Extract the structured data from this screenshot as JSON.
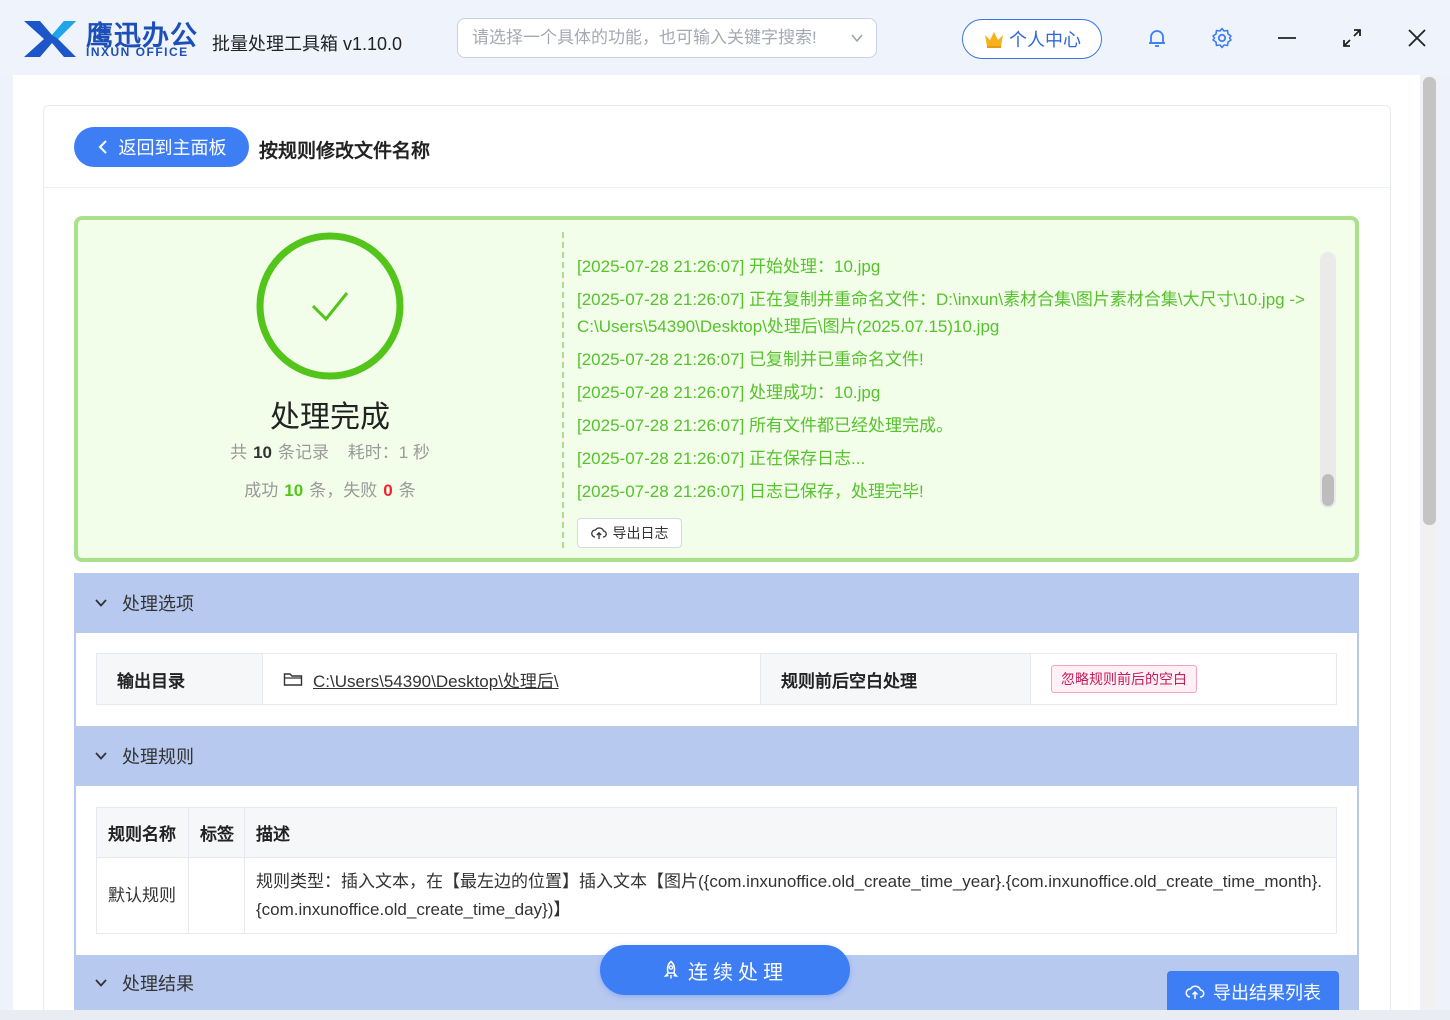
{
  "header": {
    "brand_cn": "鹰迅办公",
    "brand_en": "INXUN OFFICE",
    "app_name": "批量处理工具箱 v1.10.0",
    "search_placeholder": "请选择一个具体的功能，也可输入关键字搜索!",
    "user_center": "个人中心",
    "icons": [
      "logo-icon",
      "crown-icon",
      "bell-icon",
      "gear-icon",
      "minimize-icon",
      "maximize-icon",
      "close-icon"
    ]
  },
  "page": {
    "back_label": "返回到主面板",
    "title": "按规则修改文件名称"
  },
  "result": {
    "status": "处理完成",
    "total_prefix": "共",
    "total": "10",
    "total_suffix": "条记录",
    "time_label": "耗时：1 秒",
    "success_prefix": "成功",
    "success": "10",
    "success_suffix": "条，失败",
    "fail": "0",
    "fail_suffix": "条",
    "export_log": "导出日志",
    "logs": [
      "[2025-07-28 21:26:07] 开始处理：10.jpg",
      "[2025-07-28 21:26:07] 正在复制并重命名文件：D:\\inxun\\素材合集\\图片素材合集\\大尺寸\\10.jpg -> C:\\Users\\54390\\Desktop\\处理后\\图片(2025.07.15)10.jpg",
      "[2025-07-28 21:26:07] 已复制并已重命名文件!",
      "[2025-07-28 21:26:07] 处理成功：10.jpg",
      "[2025-07-28 21:26:07] 所有文件都已经处理完成。",
      "[2025-07-28 21:26:07] 正在保存日志...",
      "[2025-07-28 21:26:07] 日志已保存，处理完毕!"
    ]
  },
  "options": {
    "section_title": "处理选项",
    "output_dir_label": "输出目录",
    "output_dir_value": "C:\\Users\\54390\\Desktop\\处理后\\",
    "whitespace_label": "规则前后空白处理",
    "whitespace_value": "忽略规则前后的空白"
  },
  "rules": {
    "section_title": "处理规则",
    "columns": [
      "规则名称",
      "标签",
      "描述"
    ],
    "rows": [
      {
        "name": "默认规则",
        "tag": "",
        "description": "规则类型：插入文本，在【最左边的位置】插入文本【图片({com.inxunoffice.old_create_time_year}.{com.inxunoffice.old_create_time_month}.{com.inxunoffice.old_create_time_day})】"
      }
    ]
  },
  "results": {
    "section_title": "处理结果",
    "export_label": "导出结果列表"
  },
  "actions": {
    "continue_label": "连续处理"
  },
  "colors": {
    "accent": "#3e7ef5",
    "success": "#52c41a",
    "success_border": "#a8e18a",
    "section_bg": "#b8c9ef"
  }
}
